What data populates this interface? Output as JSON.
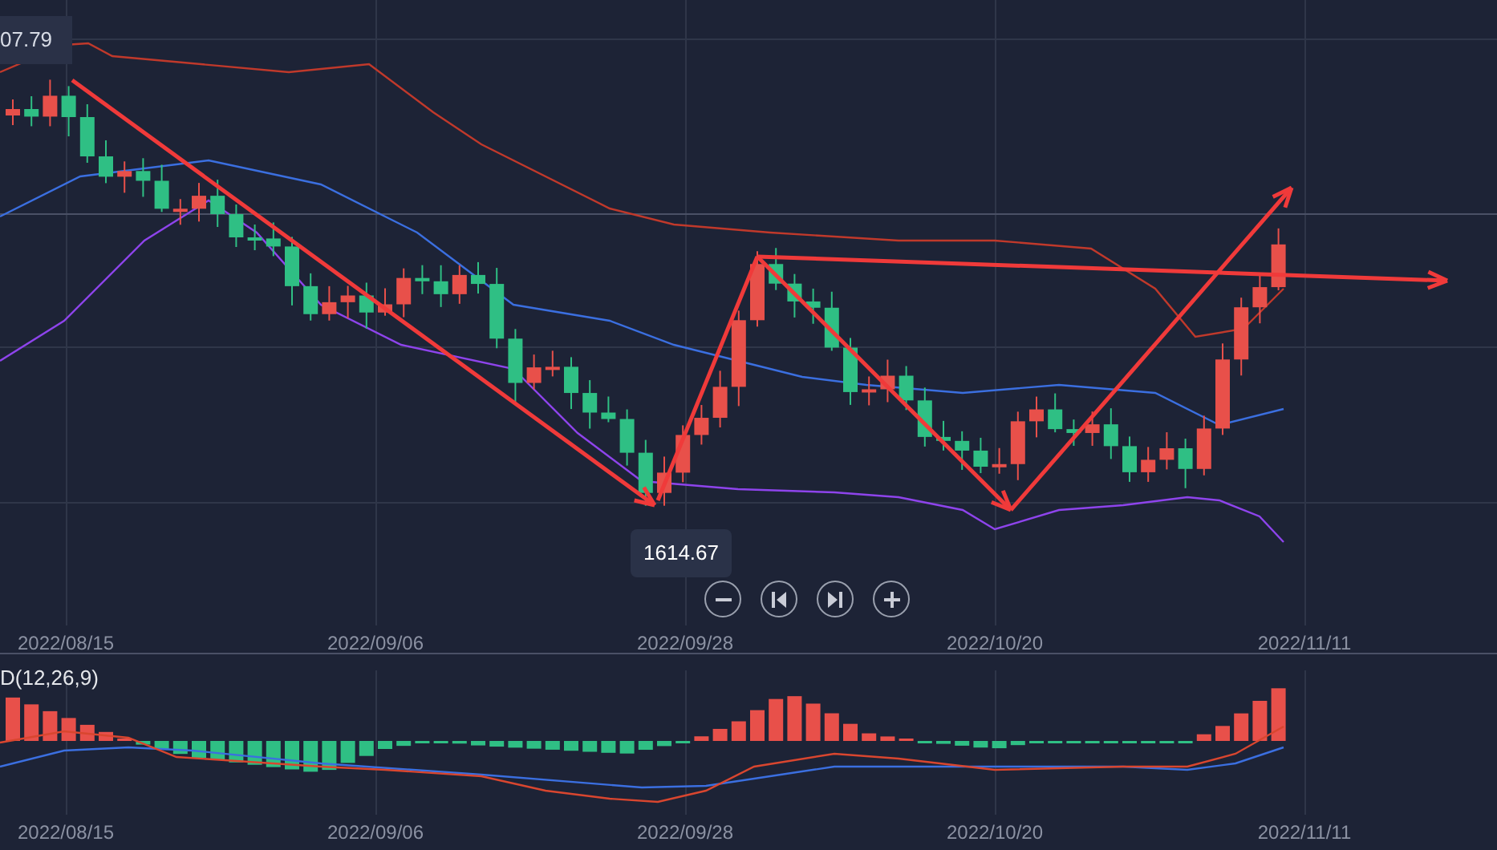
{
  "price_chart": {
    "price_label": "07.79",
    "low_tooltip": "1614.67",
    "controls": [
      {
        "kind": "zoom_out"
      },
      {
        "kind": "step_back"
      },
      {
        "kind": "step_forward"
      },
      {
        "kind": "zoom_in"
      }
    ],
    "date_axis": [
      "2022/08/15",
      "2022/09/06",
      "2022/09/28",
      "2022/10/20",
      "2022/11/11"
    ]
  },
  "macd_panel": {
    "label": "D(12,26,9)",
    "date_axis": [
      "2022/08/15",
      "2022/09/06",
      "2022/09/28",
      "2022/10/20",
      "2022/11/11"
    ]
  }
}
